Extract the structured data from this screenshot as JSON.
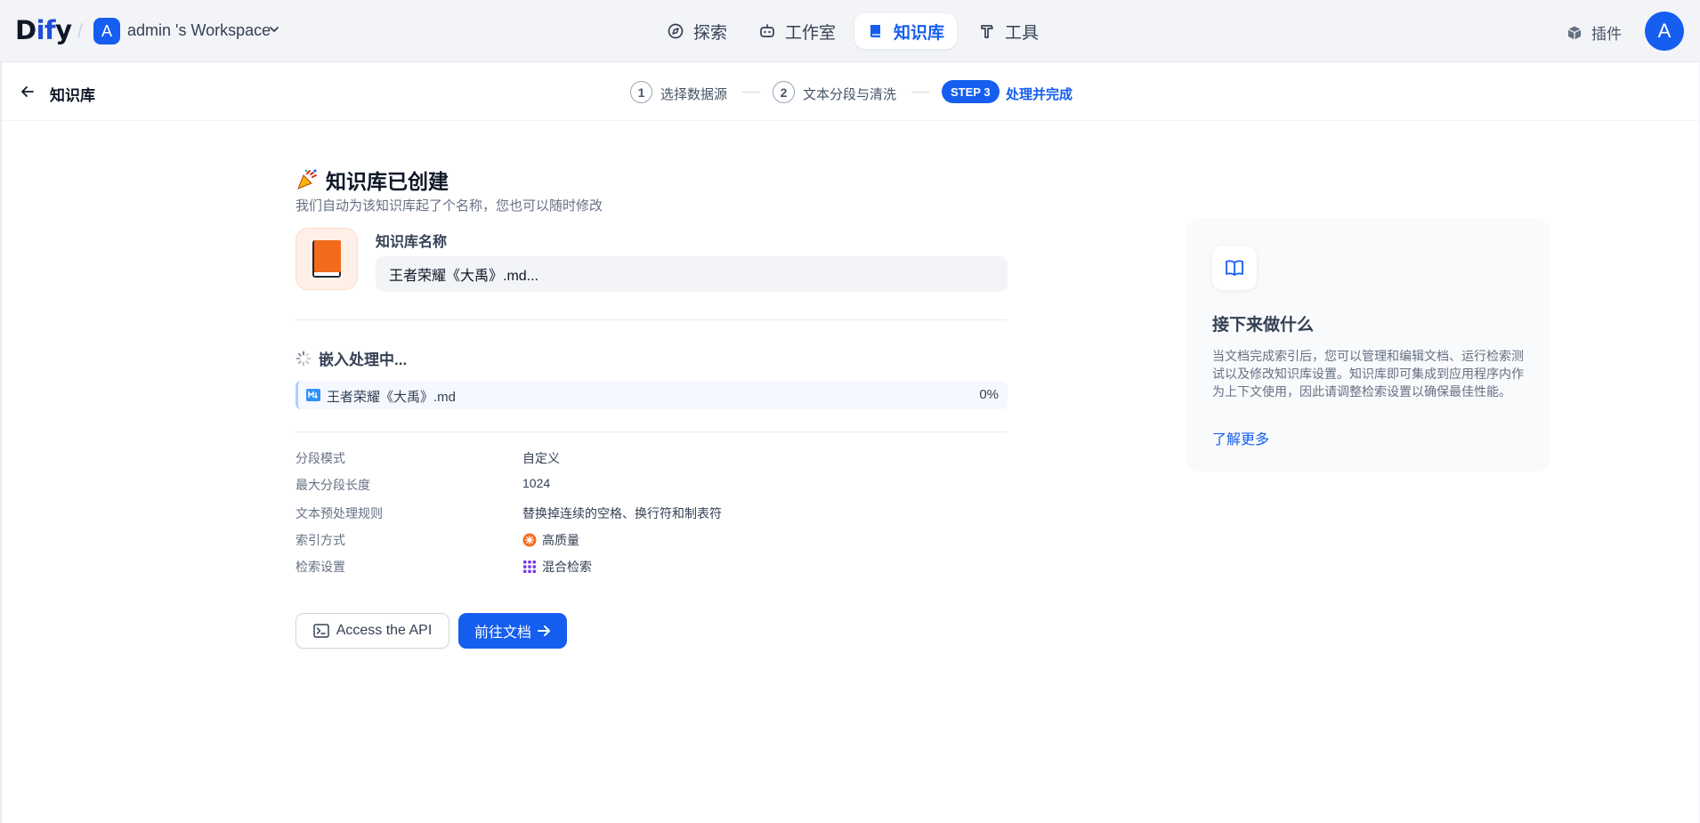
{
  "header": {
    "logo_text": "Dify",
    "workspace": {
      "avatar": "A",
      "name": "admin 's Workspace"
    },
    "nav": [
      {
        "label": "探索",
        "icon": "compass-icon",
        "active": false
      },
      {
        "label": "工作室",
        "icon": "robot-icon",
        "active": false
      },
      {
        "label": "知识库",
        "icon": "book-icon",
        "active": true
      },
      {
        "label": "工具",
        "icon": "hammer-icon",
        "active": false
      }
    ],
    "plugins_label": "插件",
    "user_avatar": "A"
  },
  "subbar": {
    "title": "知识库",
    "steps": [
      {
        "number": "1",
        "label": "选择数据源"
      },
      {
        "number": "2",
        "label": "文本分段与清洗"
      },
      {
        "number": "STEP 3",
        "label": "处理并完成",
        "active": true
      }
    ]
  },
  "content": {
    "title": "知识库已创建",
    "subtitle": "我们自动为该知识库起了个名称，您也可以随时修改",
    "name_label": "知识库名称",
    "name_value": "王者荣耀《大禹》.md...",
    "embedding_title": "嵌入处理中...",
    "file": {
      "name": "王者荣耀《大禹》.md",
      "progress": "0%"
    },
    "meta": [
      {
        "label": "分段模式",
        "value": "自定义"
      },
      {
        "label": "最大分段长度",
        "value": "1024"
      },
      {
        "label": "文本预处理规则",
        "value": "替换掉连续的空格、换行符和制表符"
      },
      {
        "label": "索引方式",
        "value": "高质量",
        "icon": "quality-icon"
      },
      {
        "label": "检索设置",
        "value": "混合检索",
        "icon": "hybrid-search-icon"
      }
    ],
    "buttons": {
      "api": "Access the API",
      "docs": "前往文档"
    }
  },
  "next_card": {
    "title": "接下来做什么",
    "description": "当文档完成索引后，您可以管理和编辑文档、运行检索测试以及修改知识库设置。知识库即可集成到应用程序内作为上下文使用，因此请调整检索设置以确保最佳性能。",
    "link": "了解更多"
  },
  "colors": {
    "primary": "#155eef",
    "background": "#f2f4f7",
    "quality_orange": "#f26b1d",
    "hybrid_purple": "#7839ee"
  }
}
